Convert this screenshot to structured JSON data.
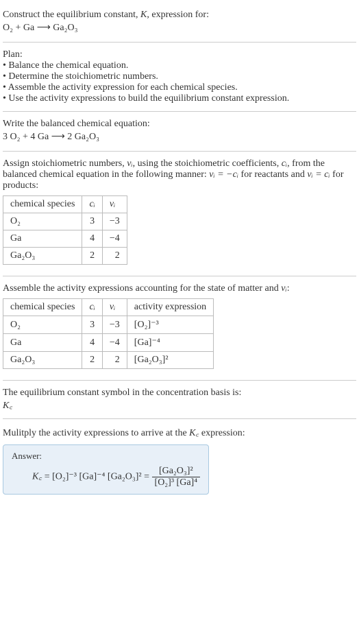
{
  "header": {
    "title_line1": "Construct the equilibrium constant, ",
    "title_K": "K",
    "title_line1b": ", expression for:",
    "eq_unbalanced": "O₂ + Ga ⟶ Ga₂O₃"
  },
  "plan": {
    "label": "Plan:",
    "items": [
      "Balance the chemical equation.",
      "Determine the stoichiometric numbers.",
      "Assemble the activity expression for each chemical species.",
      "Use the activity expressions to build the equilibrium constant expression."
    ]
  },
  "balanced": {
    "label": "Write the balanced chemical equation:",
    "eq": "3 O₂ + 4 Ga ⟶ 2 Ga₂O₃"
  },
  "stoich": {
    "text1": "Assign stoichiometric numbers, ",
    "nu_i": "νᵢ",
    "text2": ", using the stoichiometric coefficients, ",
    "c_i": "cᵢ",
    "text3": ", from the balanced chemical equation in the following manner: ",
    "rel1": "νᵢ = −cᵢ",
    "text4": " for reactants and ",
    "rel2": "νᵢ = cᵢ",
    "text5": " for products:",
    "table": {
      "headers": [
        "chemical species",
        "cᵢ",
        "νᵢ"
      ],
      "rows": [
        {
          "species": "O₂",
          "c": "3",
          "nu": "−3"
        },
        {
          "species": "Ga",
          "c": "4",
          "nu": "−4"
        },
        {
          "species": "Ga₂O₃",
          "c": "2",
          "nu": "2"
        }
      ]
    }
  },
  "activity": {
    "text1": "Assemble the activity expressions accounting for the state of matter and ",
    "nu_i": "νᵢ",
    "text2": ":",
    "table": {
      "headers": [
        "chemical species",
        "cᵢ",
        "νᵢ",
        "activity expression"
      ],
      "rows": [
        {
          "species": "O₂",
          "c": "3",
          "nu": "−3",
          "expr": "[O₂]⁻³"
        },
        {
          "species": "Ga",
          "c": "4",
          "nu": "−4",
          "expr": "[Ga]⁻⁴"
        },
        {
          "species": "Ga₂O₃",
          "c": "2",
          "nu": "2",
          "expr": "[Ga₂O₃]²"
        }
      ]
    }
  },
  "symbol": {
    "text": "The equilibrium constant symbol in the concentration basis is:",
    "kc": "K꜀"
  },
  "multiply": {
    "text1": "Mulitply the activity expressions to arrive at the ",
    "kc": "K꜀",
    "text2": " expression:"
  },
  "answer": {
    "label": "Answer:",
    "kc": "K꜀",
    "eq_part1": " = [O₂]⁻³ [Ga]⁻⁴ [Ga₂O₃]² = ",
    "frac_num": "[Ga₂O₃]²",
    "frac_den": "[O₂]³ [Ga]⁴"
  }
}
